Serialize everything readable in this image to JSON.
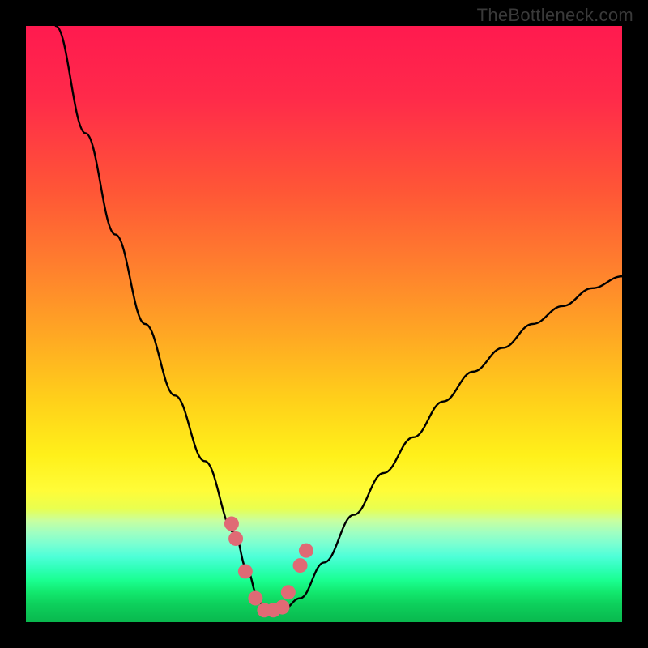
{
  "watermark": "TheBottleneck.com",
  "chart_data": {
    "type": "line",
    "title": "",
    "xlabel": "",
    "ylabel": "",
    "xlim": [
      0,
      100
    ],
    "ylim": [
      0,
      100
    ],
    "grid": false,
    "series": [
      {
        "name": "bottleneck-curve",
        "color": "#000000",
        "x": [
          5,
          10,
          15,
          20,
          25,
          30,
          35,
          37,
          39,
          40,
          43,
          46,
          50,
          55,
          60,
          65,
          70,
          75,
          80,
          85,
          90,
          95,
          100
        ],
        "y": [
          100,
          82,
          65,
          50,
          38,
          27,
          15,
          9,
          4,
          2,
          2,
          4,
          10,
          18,
          25,
          31,
          37,
          42,
          46,
          50,
          53,
          56,
          58
        ]
      }
    ],
    "markers": {
      "name": "bottleneck-dots",
      "color": "#e06a75",
      "x": [
        34.5,
        35.2,
        36.8,
        38.5,
        40.0,
        41.5,
        43.0,
        44.0,
        46.0,
        47.0
      ],
      "y": [
        16.5,
        14.0,
        8.5,
        4.0,
        2.0,
        2.0,
        2.5,
        5.0,
        9.5,
        12.0
      ]
    },
    "annotations": []
  }
}
